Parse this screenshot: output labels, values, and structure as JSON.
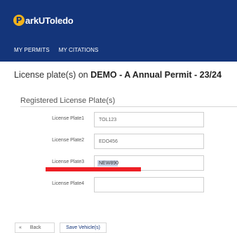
{
  "brand": {
    "logo_letter": "P",
    "logo_text": "arkUToledo"
  },
  "nav": {
    "items": [
      "MY PERMITS",
      "MY CITATIONS"
    ]
  },
  "page": {
    "title_prefix": "License plate(s) on ",
    "title_bold": "DEMO - A Annual Permit - 23/24"
  },
  "section": {
    "title": "Registered License Plate(s)"
  },
  "plates": [
    {
      "label": "License Plate1",
      "value": "TOL123"
    },
    {
      "label": "License Plate2",
      "value": "EDO456"
    },
    {
      "label": "License Plate3",
      "value": "NEW890"
    },
    {
      "label": "License Plate4",
      "value": ""
    }
  ],
  "buttons": {
    "back_icon": "«",
    "back": "Back",
    "save": "Save Vehicle(s)"
  },
  "colors": {
    "header": "#14357a",
    "logo_accent": "#f2b21a",
    "annotation": "#ee1f25"
  }
}
